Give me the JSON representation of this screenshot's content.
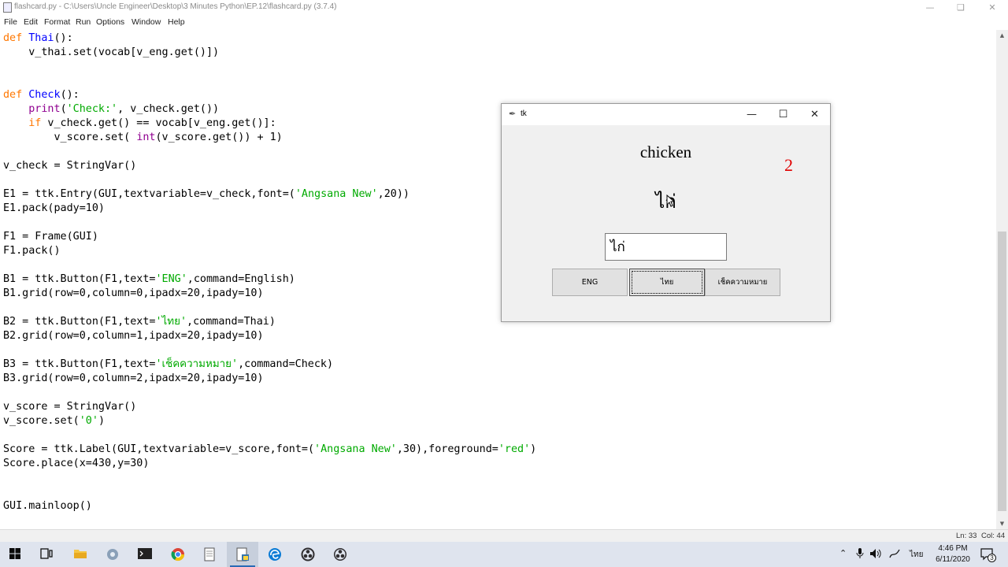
{
  "idle": {
    "title": "flashcard.py - C:\\Users\\Uncle Engineer\\Desktop\\3 Minutes Python\\EP.12\\flashcard.py (3.7.4)",
    "menu": [
      "File",
      "Edit",
      "Format",
      "Run",
      "Options",
      "Window",
      "Help"
    ],
    "status": {
      "line": "Ln: 33",
      "col": "Col: 44"
    }
  },
  "code": {
    "l1": {
      "kw": "def",
      "fn": "Thai",
      "rest": "():"
    },
    "l2": "    v_thai.set(vocab[v_eng.get()])",
    "l3": {
      "kw": "def",
      "fn": "Check",
      "rest": "():"
    },
    "l4": {
      "ind": "    ",
      "bi": "print",
      "a": "(",
      "s": "'Check:'",
      "b": ", v_check.get())"
    },
    "l5": {
      "ind": "    ",
      "kw": "if",
      "rest": " v_check.get() == vocab[v_eng.get()]:"
    },
    "l6": {
      "a": "        v_score.set( ",
      "bi": "int",
      "b": "(v_score.get()) + 1)"
    },
    "l7": "v_check = StringVar()",
    "l8": {
      "a": "E1 = ttk.Entry(GUI,textvariable=v_check,font=(",
      "s": "'Angsana New'",
      "b": ",20))"
    },
    "l9": "E1.pack(pady=10)",
    "l10": "F1 = Frame(GUI)",
    "l11": "F1.pack()",
    "l12": {
      "a": "B1 = ttk.Button(F1,text=",
      "s": "'ENG'",
      "b": ",command=English)"
    },
    "l13": "B1.grid(row=0,column=0,ipadx=20,ipady=10)",
    "l14": {
      "a": "B2 = ttk.Button(F1,text=",
      "s": "'ไทย'",
      "b": ",command=Thai)"
    },
    "l15": "B2.grid(row=0,column=1,ipadx=20,ipady=10)",
    "l16": {
      "a": "B3 = ttk.Button(F1,text=",
      "s": "'เช็คความหมาย'",
      "b": ",command=Check)"
    },
    "l17": "B3.grid(row=0,column=2,ipadx=20,ipady=10)",
    "l18": "v_score = StringVar()",
    "l19": {
      "a": "v_score.set(",
      "s": "'0'",
      "b": ")"
    },
    "l20": {
      "a": "Score = ttk.Label(GUI,textvariable=v_score,font=(",
      "s": "'Angsana New'",
      "b": ",30),foreground=",
      "s2": "'red'",
      "c": ")"
    },
    "l21": "Score.place(x=430,y=30)",
    "l22": "GUI.mainloop()"
  },
  "tk": {
    "title": "tk",
    "english_word": "chicken",
    "score": "2",
    "thai_word": "ไก่",
    "entry_value": "ไก่",
    "buttons": {
      "eng": "ENG",
      "thai": "ไทย",
      "check": "เช็คความหมาย"
    }
  },
  "taskbar": {
    "time": "4:46 PM",
    "date": "6/11/2020",
    "language": "ไทย",
    "notifications": "3"
  },
  "colors": {
    "keyword": "#ff7700",
    "definition": "#0000ff",
    "string": "#00aa00",
    "builtin": "#900090",
    "score": "#e00000"
  },
  "icons": [
    "windows-start-icon",
    "task-view-icon",
    "file-explorer-icon",
    "app-icon",
    "terminal-icon",
    "chrome-icon",
    "notepad-icon",
    "idle-icon",
    "edge-icon",
    "obs-icon",
    "obs-icon"
  ]
}
